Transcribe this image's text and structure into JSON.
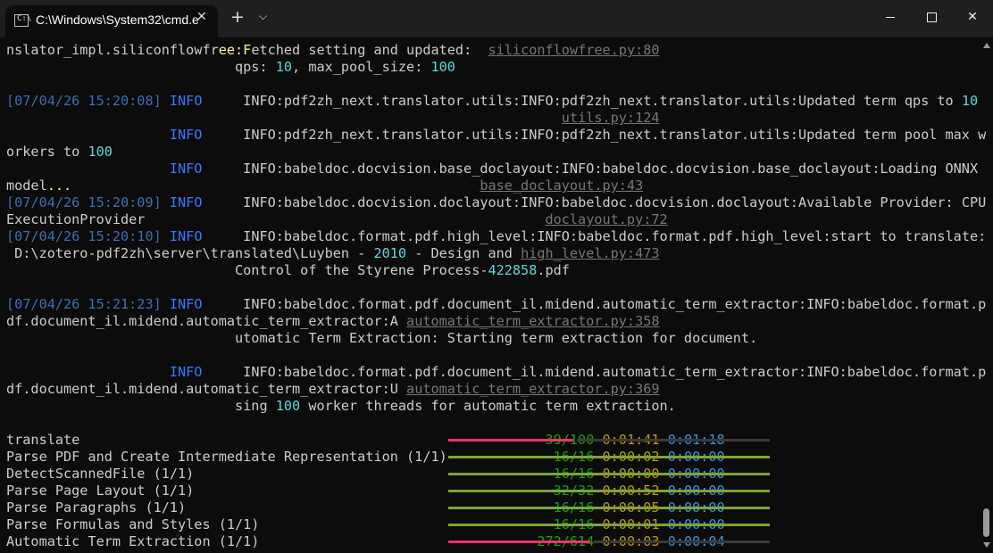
{
  "window": {
    "tab_title": "C:\\Windows\\System32\\cmd.e",
    "tab_icon_text": "C:\\"
  },
  "terminal": {
    "lines": [
      [
        {
          "t": "nslator_impl.siliconflowfr"
        },
        {
          "t": "ee:F",
          "c": "yel"
        },
        {
          "t": "etched setting and updated:  "
        },
        {
          "t": "siliconflowfree.py:80",
          "c": "file"
        }
      ],
      [
        {
          "t": "                            qps: "
        },
        {
          "t": "10",
          "c": "num"
        },
        {
          "t": ", max_pool_size: "
        },
        {
          "t": "100",
          "c": "num"
        }
      ],
      [],
      [
        {
          "t": "[07/04/26 15:20:08]",
          "c": "ts"
        },
        {
          "t": " "
        },
        {
          "t": "INFO",
          "c": "info"
        },
        {
          "t": "     INFO:pdf2zh_next.translator.utils:INFO:pdf2zh_next.translator.utils:Updated term qps to "
        },
        {
          "t": "10",
          "c": "num"
        }
      ],
      [
        {
          "t": "                                                                    "
        },
        {
          "t": "utils.py:124",
          "c": "file"
        }
      ],
      [
        {
          "t": "                    "
        },
        {
          "t": "INFO",
          "c": "info"
        },
        {
          "t": "     INFO:pdf2zh_next.translator.utils:INFO:pdf2zh_next.translator.utils:Updated term pool max w"
        }
      ],
      [
        {
          "t": "orkers to "
        },
        {
          "t": "100",
          "c": "num"
        }
      ],
      [
        {
          "t": "                    "
        },
        {
          "t": "INFO",
          "c": "info"
        },
        {
          "t": "     INFO:babeldoc.docvision.base_doclayout:INFO:babeldoc.docvision.base_doclayout:Loading ONNX"
        }
      ],
      [
        {
          "t": "model"
        },
        {
          "t": "...",
          "c": "yel"
        },
        {
          "t": "                                                  "
        },
        {
          "t": "base_doclayout.py:43",
          "c": "file"
        }
      ],
      [
        {
          "t": "[07/04/26 15:20:09]",
          "c": "ts"
        },
        {
          "t": " "
        },
        {
          "t": "INFO",
          "c": "info"
        },
        {
          "t": "     INFO:babeldoc.docvision.doclayout:INFO:babeldoc.docvision.doclayout:Available Provider: CPU"
        }
      ],
      [
        {
          "t": "ExecutionProvider                                                 "
        },
        {
          "t": "doclayout.py:72",
          "c": "file"
        }
      ],
      [
        {
          "t": "[07/04/26 15:20:10]",
          "c": "ts"
        },
        {
          "t": " "
        },
        {
          "t": "INFO",
          "c": "info"
        },
        {
          "t": "     INFO:babeldoc.format.pdf.high_level:INFO:babeldoc.format.pdf.high_level:start to translate:"
        }
      ],
      [
        {
          "t": " D:\\zotero-pdf2zh\\server\\translated\\Luyben - "
        },
        {
          "t": "2010",
          "c": "num"
        },
        {
          "t": " - Design and "
        },
        {
          "t": "high_level.py:473",
          "c": "file"
        }
      ],
      [
        {
          "t": "                            Control of the Styrene Process-"
        },
        {
          "t": "422858",
          "c": "num"
        },
        {
          "t": ".pdf"
        }
      ],
      [],
      [
        {
          "t": "[07/04/26 15:21:23]",
          "c": "ts"
        },
        {
          "t": " "
        },
        {
          "t": "INFO",
          "c": "info"
        },
        {
          "t": "     INFO:babeldoc.format.pdf.document_il.midend.automatic_term_extractor:INFO:babeldoc.format.p"
        }
      ],
      [
        {
          "t": "df.document_il.midend.automatic_term_extractor:A "
        },
        {
          "t": "automatic_term_extractor.py:358",
          "c": "file"
        }
      ],
      [
        {
          "t": "                            utomatic Term Extraction: Starting term extraction for document."
        }
      ],
      [],
      [
        {
          "t": "                    "
        },
        {
          "t": "INFO",
          "c": "info"
        },
        {
          "t": "     INFO:babeldoc.format.pdf.document_il.midend.automatic_term_extractor:INFO:babeldoc.format.p"
        }
      ],
      [
        {
          "t": "df.document_il.midend.automatic_term_extractor:U "
        },
        {
          "t": "automatic_term_extractor.py:369",
          "c": "file"
        }
      ],
      [
        {
          "t": "                            sing "
        },
        {
          "t": "100",
          "c": "num"
        },
        {
          "t": " worker threads for automatic term extraction."
        }
      ],
      [],
      [
        {
          "t": "translate                                                    "
        },
        {
          "t": "     39/100",
          "c": "grn"
        },
        {
          "t": " "
        },
        {
          "t": "0:01:41",
          "c": "gold"
        },
        {
          "t": " "
        },
        {
          "t": "0:01:18",
          "c": "cyan"
        }
      ],
      [
        {
          "t": "Parse PDF and Create Intermediate Representation (1/1)       "
        },
        {
          "t": "      16/16",
          "c": "grn"
        },
        {
          "t": " "
        },
        {
          "t": "0:00:02",
          "c": "gold"
        },
        {
          "t": " "
        },
        {
          "t": "0:00:00",
          "c": "cyan"
        }
      ],
      [
        {
          "t": "DetectScannedFile (1/1)                                      "
        },
        {
          "t": "      16/16",
          "c": "grn"
        },
        {
          "t": " "
        },
        {
          "t": "0:00:00",
          "c": "gold"
        },
        {
          "t": " "
        },
        {
          "t": "0:00:00",
          "c": "cyan"
        }
      ],
      [
        {
          "t": "Parse Page Layout (1/1)                                      "
        },
        {
          "t": "      32/32",
          "c": "grn"
        },
        {
          "t": " "
        },
        {
          "t": "0:00:52",
          "c": "gold"
        },
        {
          "t": " "
        },
        {
          "t": "0:00:00",
          "c": "cyan"
        }
      ],
      [
        {
          "t": "Parse Paragraphs (1/1)                                       "
        },
        {
          "t": "      16/16",
          "c": "grn"
        },
        {
          "t": " "
        },
        {
          "t": "0:00:05",
          "c": "gold"
        },
        {
          "t": " "
        },
        {
          "t": "0:00:00",
          "c": "cyan"
        }
      ],
      [
        {
          "t": "Parse Formulas and Styles (1/1)                              "
        },
        {
          "t": "      16/16",
          "c": "grn"
        },
        {
          "t": " "
        },
        {
          "t": "0:00:01",
          "c": "gold"
        },
        {
          "t": " "
        },
        {
          "t": "0:00:00",
          "c": "cyan"
        }
      ],
      [
        {
          "t": "Automatic Term Extraction (1/1)                              "
        },
        {
          "t": "    272/614",
          "c": "grn"
        },
        {
          "t": " "
        },
        {
          "t": "0:00:03",
          "c": "gold"
        },
        {
          "t": " "
        },
        {
          "t": "0:00:04",
          "c": "cyan"
        }
      ]
    ]
  },
  "progress": [
    {
      "task": "translate",
      "fraction": 0.39
    },
    {
      "task": "Parse PDF and Create Intermediate Representation (1/1)",
      "fraction": 1
    },
    {
      "task": "DetectScannedFile (1/1)",
      "fraction": 1
    },
    {
      "task": "Parse Page Layout (1/1)",
      "fraction": 1
    },
    {
      "task": "Parse Paragraphs (1/1)",
      "fraction": 1
    },
    {
      "task": "Parse Formulas and Styles (1/1)",
      "fraction": 1
    },
    {
      "task": "Automatic Term Extraction (1/1)",
      "fraction": 0.443
    }
  ],
  "colors": {
    "ts": "#3f6db7",
    "info": "#3b78ff",
    "num": "#61d6d6",
    "yel": "#f9f1a5",
    "file": "#767676",
    "grn": "#13a10e",
    "gold": "#c19c00",
    "cyan": "#3a96dd",
    "pink": "#ff2f6d",
    "gray": "#3a3a3a",
    "green": "#7fa33a"
  }
}
